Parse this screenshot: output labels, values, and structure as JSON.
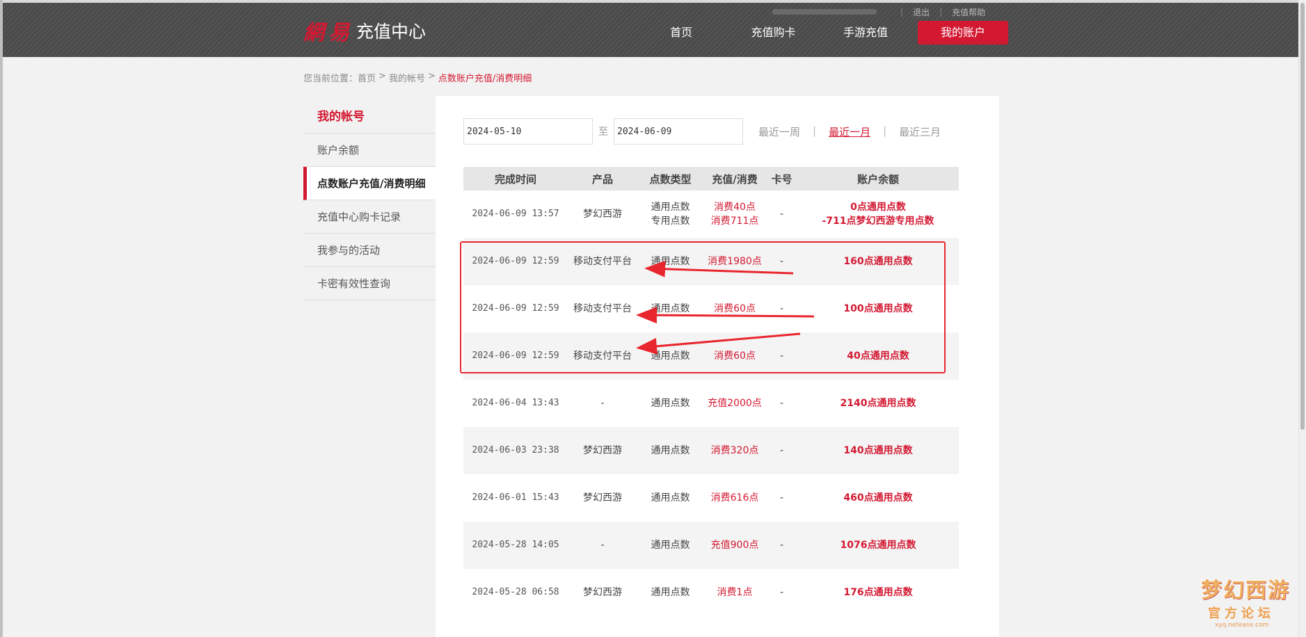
{
  "header": {
    "brand": "網易",
    "title": "充值中心",
    "top_links": {
      "logout": "退出",
      "help": "充值帮助"
    },
    "nav": [
      "首页",
      "充值购卡",
      "手游充值",
      "我的账户"
    ]
  },
  "breadcrumb": {
    "prefix": "您当前位置：",
    "items": [
      "首页",
      "我的帐号"
    ],
    "current": "点数账户充值/消费明细"
  },
  "sidebar": {
    "title": "我的帐号",
    "items": [
      {
        "label": "账户余额"
      },
      {
        "label": "点数账户充值/消费明细",
        "active": true
      },
      {
        "label": "充值中心购卡记录"
      },
      {
        "label": "我参与的活动"
      },
      {
        "label": "卡密有效性查询"
      }
    ]
  },
  "filter": {
    "start_date": "2024-05-10",
    "to": "至",
    "end_date": "2024-06-09",
    "ranges": [
      "最近一周",
      "最近一月",
      "最近三月"
    ],
    "active_range": "最近一月"
  },
  "table": {
    "headers": [
      "完成时间",
      "产品",
      "点数类型",
      "充值/消费",
      "卡号",
      "账户余额"
    ],
    "rows": [
      {
        "time": "2024-06-09 13:57",
        "product": "梦幻西游",
        "type": "通用点数",
        "type2": "专用点数",
        "amount": "消费40点",
        "amount2": "消费711点",
        "card": "-",
        "balance": "0点通用点数",
        "balance2": "-711点梦幻西游专用点数"
      },
      {
        "time": "2024-06-09 12:59",
        "product": "移动支付平台",
        "type": "通用点数",
        "amount": "消费1980点",
        "card": "-",
        "balance": "160点通用点数"
      },
      {
        "time": "2024-06-09 12:59",
        "product": "移动支付平台",
        "type": "通用点数",
        "amount": "消费60点",
        "card": "-",
        "balance": "100点通用点数"
      },
      {
        "time": "2024-06-09 12:59",
        "product": "移动支付平台",
        "type": "通用点数",
        "amount": "消费60点",
        "card": "-",
        "balance": "40点通用点数"
      },
      {
        "time": "2024-06-04 13:43",
        "product": "-",
        "type": "通用点数",
        "amount": "充值2000点",
        "card": "-",
        "balance": "2140点通用点数"
      },
      {
        "time": "2024-06-03 23:38",
        "product": "梦幻西游",
        "type": "通用点数",
        "amount": "消费320点",
        "card": "-",
        "balance": "140点通用点数"
      },
      {
        "time": "2024-06-01 15:43",
        "product": "梦幻西游",
        "type": "通用点数",
        "amount": "消费616点",
        "card": "-",
        "balance": "460点通用点数"
      },
      {
        "time": "2024-05-28 14:05",
        "product": "-",
        "type": "通用点数",
        "amount": "充值900点",
        "card": "-",
        "balance": "1076点通用点数"
      },
      {
        "time": "2024-05-28 06:58",
        "product": "梦幻西游",
        "type": "通用点数",
        "amount": "消费1点",
        "card": "-",
        "balance": "176点通用点数"
      }
    ]
  },
  "watermark": {
    "title": "梦幻西游",
    "sub": "官方论坛",
    "url": "xyq.netease.com"
  },
  "colors": {
    "accent": "#d31932",
    "header_bg": "#4a4a4a",
    "annotation": "#e8262e"
  }
}
